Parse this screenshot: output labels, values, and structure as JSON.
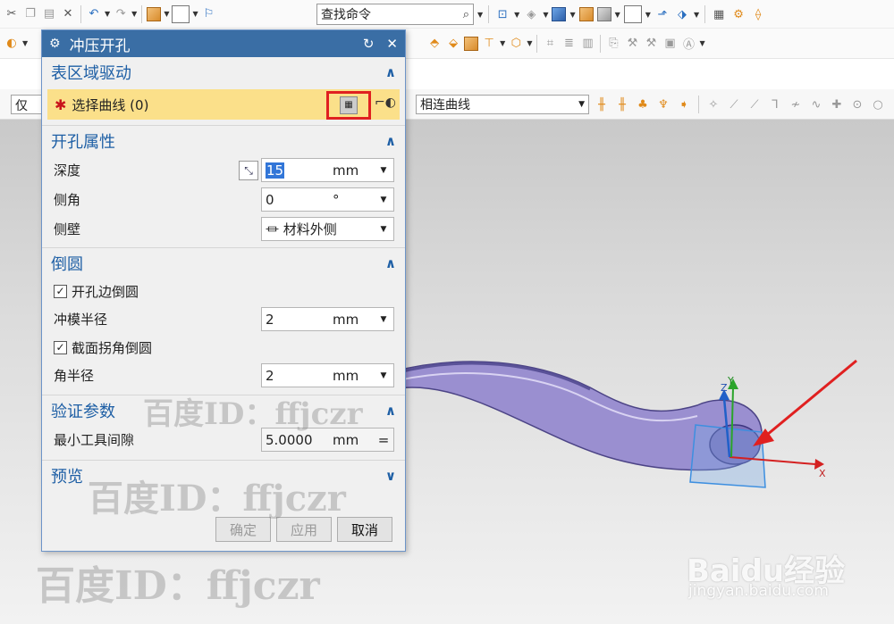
{
  "toolbar": {
    "find_placeholder": "查找命令"
  },
  "selection_bar": {
    "left_filter": "仅在",
    "curve_rule": "相连曲线"
  },
  "dialog": {
    "title": "冲压开孔",
    "groups": {
      "surface_drive": {
        "title": "表区域驱动",
        "select_curve_label": "选择曲线 (0)"
      },
      "hole_props": {
        "title": "开孔属性",
        "depth_label": "深度",
        "depth_value": "15",
        "depth_unit": "mm",
        "side_angle_label": "侧角",
        "side_angle_value": "0",
        "side_angle_unit": "°",
        "side_wall_label": "侧壁",
        "side_wall_value": "材料外侧"
      },
      "rounding": {
        "title": "倒圆",
        "hole_edge_round_label": "开孔边倒圆",
        "hole_edge_round_checked": true,
        "die_radius_label": "冲模半径",
        "die_radius_value": "2",
        "die_radius_unit": "mm",
        "section_corner_round_label": "截面拐角倒圆",
        "section_corner_round_checked": true,
        "corner_radius_label": "角半径",
        "corner_radius_value": "2",
        "corner_radius_unit": "mm"
      },
      "verify": {
        "title": "验证参数",
        "min_clearance_label": "最小工具间隙",
        "min_clearance_value": "5.0000",
        "min_clearance_unit": "mm"
      },
      "preview": {
        "title": "预览"
      }
    },
    "buttons": {
      "ok": "确定",
      "apply": "应用",
      "cancel": "取消"
    }
  },
  "viewport": {
    "axis_x": "X",
    "axis_y": "Y",
    "axis_z": "Z"
  },
  "watermarks": {
    "wm_text": "百度ID：ffjczr",
    "baidu_logo": "Baidu经验",
    "baidu_url": "jingyan.baidu.com"
  },
  "colors": {
    "dialog_title_bg": "#3a6ea5",
    "group_title": "#1e5fa5",
    "selection_highlight": "#fbe08a",
    "annotation_red": "#e02020",
    "part_purple": "#9a8fd0"
  }
}
